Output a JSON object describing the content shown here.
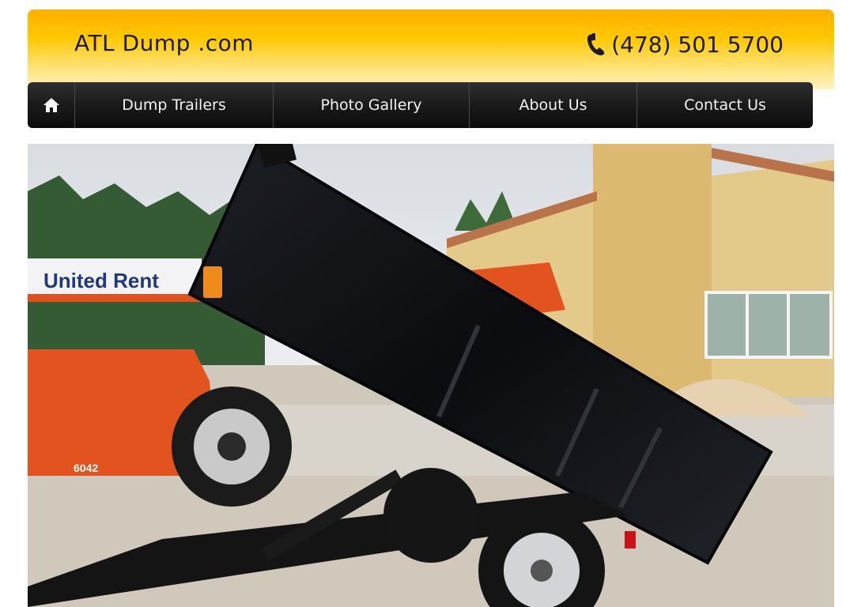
{
  "header": {
    "logo": "ATL Dump .com",
    "phone": "(478) 501 5700",
    "phone_icon": "phone-icon"
  },
  "nav": {
    "home_icon": "home-icon",
    "items": [
      {
        "label": "Dump Trailers"
      },
      {
        "label": "Photo Gallery"
      },
      {
        "label": "About Us"
      },
      {
        "label": "Contact Us"
      }
    ]
  },
  "hero": {
    "sign_text": "United Rent",
    "machine_number": "6042"
  },
  "colors": {
    "header_top": "#ffb000",
    "header_bottom": "#fff4c0",
    "nav_bg": "#1a1a1a",
    "nav_text": "#f2f2f2"
  }
}
